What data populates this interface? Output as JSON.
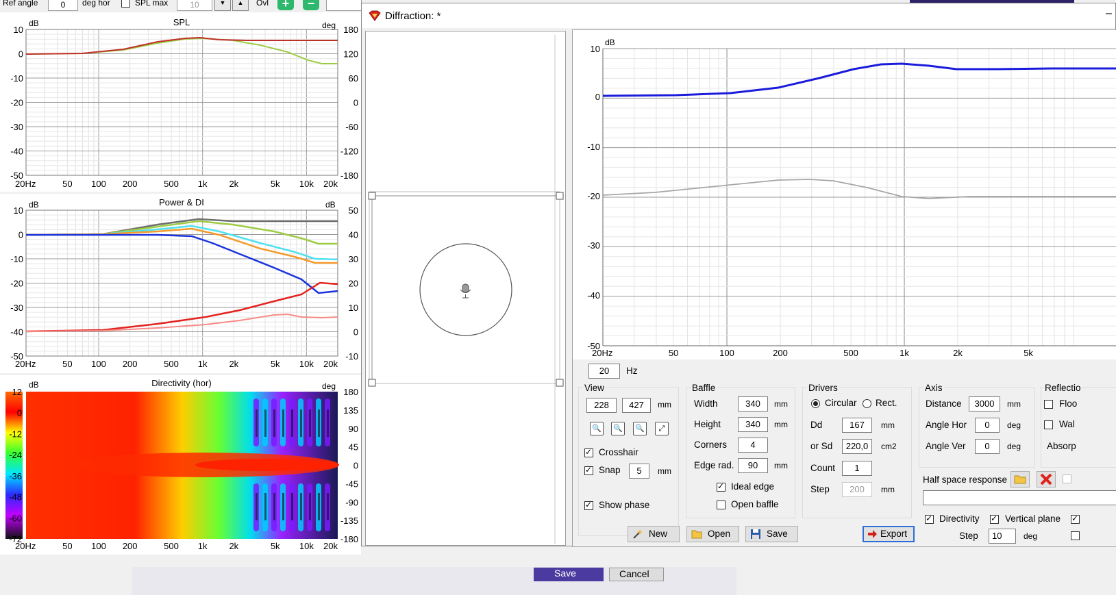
{
  "toolbar": {
    "ref_angle_label": "Ref angle",
    "ref_angle_value": "0",
    "deg_hor_label": "deg hor",
    "spl_max_label": "SPL max",
    "spl_max_value": "10",
    "ovl_label": "Ovl",
    "plus": "+",
    "minus": "−"
  },
  "spl_chart": {
    "title": "SPL",
    "ylabel_left": "dB",
    "ylabel_right": "deg",
    "yticks_left": [
      "10",
      "0",
      "-10",
      "-20",
      "-30",
      "-40",
      "-50"
    ],
    "yticks_right": [
      "180",
      "120",
      "60",
      "0",
      "-60",
      "-120",
      "-180"
    ],
    "xticks": [
      "20Hz",
      "50",
      "100",
      "200",
      "500",
      "1k",
      "2k",
      "5k",
      "10k",
      "20k"
    ]
  },
  "power_chart": {
    "title": "Power & DI",
    "ylabel_left": "dB",
    "ylabel_right": "dB",
    "yticks_left": [
      "10",
      "0",
      "-10",
      "-20",
      "-30",
      "-40",
      "-50"
    ],
    "yticks_right": [
      "50",
      "40",
      "30",
      "20",
      "10",
      "0",
      "-10"
    ],
    "xticks": [
      "20Hz",
      "50",
      "100",
      "200",
      "500",
      "1k",
      "2k",
      "5k",
      "10k",
      "20k"
    ]
  },
  "directivity_chart": {
    "title": "Directivity (hor)",
    "ylabel_left": "dB",
    "ylabel_right": "deg",
    "scale_ticks": [
      "12",
      "0",
      "-12",
      "-24",
      "-36",
      "-48",
      "-60",
      "-72"
    ],
    "yticks_right": [
      "180",
      "135",
      "90",
      "45",
      "0",
      "-45",
      "-90",
      "-135",
      "-180"
    ],
    "xticks": [
      "20Hz",
      "50",
      "100",
      "200",
      "500",
      "1k",
      "2k",
      "5k",
      "10k",
      "20k"
    ]
  },
  "background_bottom": {
    "save_label": "Save",
    "cancel_label": "Cancel"
  },
  "dialog": {
    "title": "Diffraction: *",
    "chart": {
      "ylabel": "dB",
      "yticks": [
        "10",
        "0",
        "-10",
        "-20",
        "-30",
        "-40",
        "-50"
      ],
      "xticks": [
        "20Hz",
        "50",
        "100",
        "200",
        "500",
        "1k",
        "2k",
        "5k"
      ]
    },
    "freq_value": "20",
    "freq_unit": "Hz",
    "view": {
      "label": "View",
      "x": "228",
      "y": "427",
      "unit": "mm",
      "crosshair_label": "Crosshair",
      "snap_label": "Snap",
      "snap_value": "5",
      "snap_unit": "mm",
      "show_phase_label": "Show phase"
    },
    "baffle": {
      "label": "Baffle",
      "width_label": "Width",
      "width_value": "340",
      "height_label": "Height",
      "height_value": "340",
      "corners_label": "Corners",
      "corners_value": "4",
      "edge_rad_label": "Edge rad.",
      "edge_rad_value": "90",
      "unit": "mm",
      "ideal_edge_label": "Ideal edge",
      "open_baffle_label": "Open baffle"
    },
    "drivers": {
      "label": "Drivers",
      "circular_label": "Circular",
      "rect_label": "Rect.",
      "dd_label": "Dd",
      "dd_value": "167",
      "dd_unit": "mm",
      "sd_label": "or Sd",
      "sd_value": "220,0",
      "sd_unit": "cm2",
      "count_label": "Count",
      "count_value": "1",
      "step_label": "Step",
      "step_value": "200",
      "step_unit": "mm"
    },
    "axis": {
      "label": "Axis",
      "distance_label": "Distance",
      "distance_value": "3000",
      "distance_unit": "mm",
      "angle_hor_label": "Angle Hor",
      "angle_hor_value": "0",
      "angle_ver_label": "Angle Ver",
      "angle_ver_value": "0",
      "deg_unit": "deg"
    },
    "reflections": {
      "label": "Reflectio",
      "floor_label": "Floo",
      "wall_label": "Wal",
      "absorp_label": "Absorp"
    },
    "half_space_label": "Half space response",
    "directivity_label": "Directivity",
    "vertical_plane_label": "Vertical plane",
    "step_label": "Step",
    "step_value": "10",
    "step_unit": "deg",
    "buttons": {
      "new": "New",
      "open": "Open",
      "save": "Save",
      "export": "Export"
    }
  }
}
